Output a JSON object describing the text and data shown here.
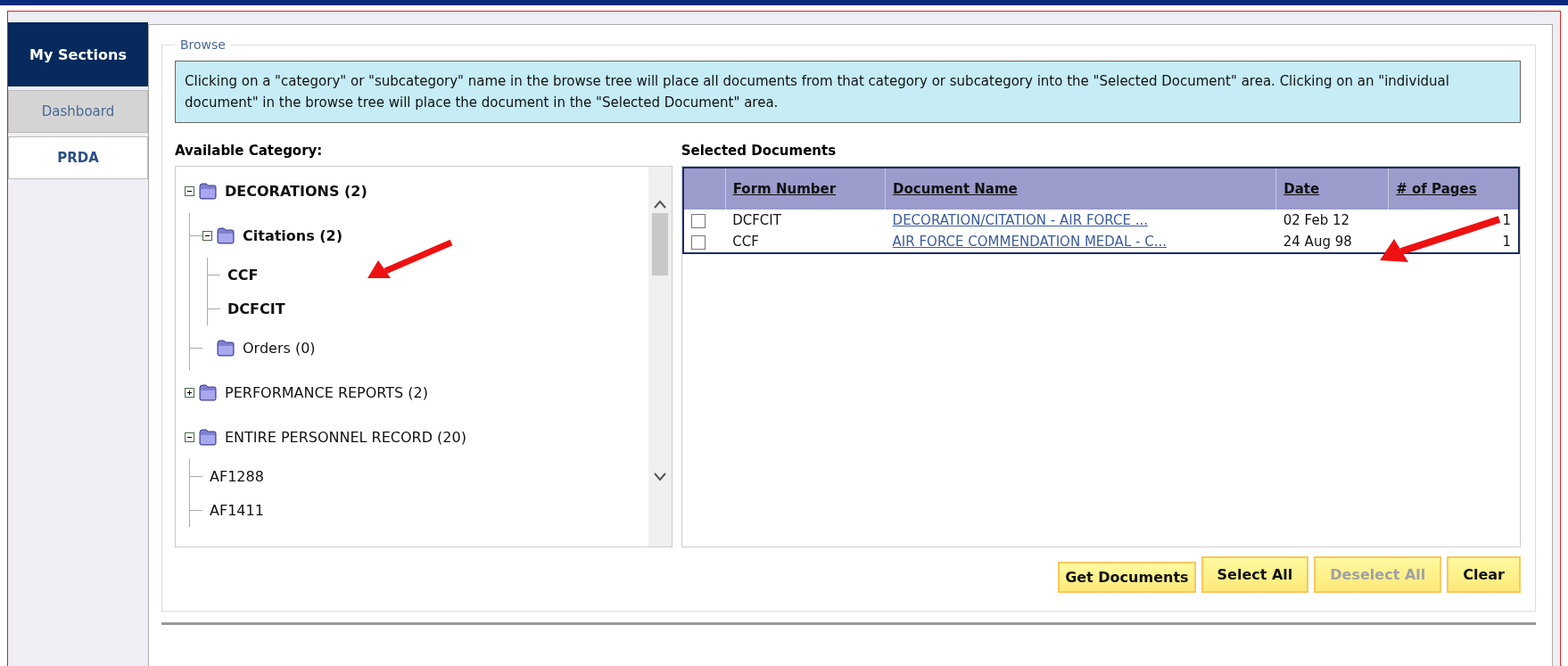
{
  "sidebar": {
    "title": "My Sections",
    "items": [
      {
        "label": "Dashboard",
        "selected": false
      },
      {
        "label": "PRDA",
        "selected": true
      }
    ]
  },
  "browse": {
    "legend": "Browse",
    "info": "Clicking on a \"category\" or \"subcategory\" name in the browse tree will place all documents from that category or subcategory into the \"Selected Document\" area. Clicking on an \"individual document\" in the browse tree will place the document in the \"Selected Document\" area.",
    "tree_title": "Available Category:",
    "tree": [
      {
        "kind": "folder",
        "label": "DECORATIONS (2)",
        "expanded": true,
        "selected": true,
        "children": [
          {
            "kind": "folder",
            "label": "Citations (2)",
            "expanded": true,
            "selected": true,
            "children": [
              {
                "kind": "document",
                "label": "CCF",
                "selected": true
              },
              {
                "kind": "document",
                "label": "DCFCIT",
                "selected": true
              }
            ]
          },
          {
            "kind": "folder",
            "label": "Orders (0)",
            "selected": false
          }
        ]
      },
      {
        "kind": "folder",
        "label": "PERFORMANCE REPORTS (2)",
        "expanded": false,
        "selected": false
      },
      {
        "kind": "folder",
        "label": "ENTIRE PERSONNEL RECORD (20)",
        "expanded": true,
        "selected": false,
        "children": [
          {
            "kind": "document",
            "label": "AF1288",
            "selected": false
          },
          {
            "kind": "document",
            "label": "AF1411",
            "selected": false
          }
        ]
      }
    ],
    "selected_title": "Selected Documents",
    "table": {
      "columns": [
        "Form Number",
        "Document Name",
        "Date",
        "# of Pages"
      ],
      "rows": [
        {
          "checked": false,
          "form_number": "DCFCIT",
          "document_name": "DECORATION/CITATION - AIR FORCE ...",
          "date": "02 Feb 12",
          "pages": "1"
        },
        {
          "checked": false,
          "form_number": "CCF",
          "document_name": "AIR FORCE COMMENDATION MEDAL - C...",
          "date": "24 Aug 98",
          "pages": "1"
        }
      ]
    },
    "buttons": [
      {
        "label": "Get Documents",
        "disabled": false
      },
      {
        "label": "Select All",
        "disabled": false
      },
      {
        "label": "Deselect All",
        "disabled": true
      },
      {
        "label": "Clear",
        "disabled": false
      }
    ]
  }
}
